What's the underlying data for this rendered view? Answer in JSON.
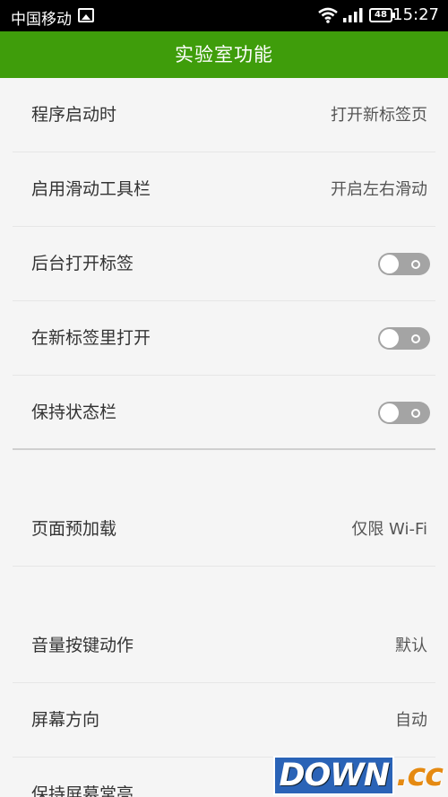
{
  "status_bar": {
    "carrier": "中国移动",
    "battery": "48",
    "time": "15:27",
    "icons": [
      "photo-icon",
      "wifi-icon",
      "signal-icon",
      "battery-icon"
    ]
  },
  "app_bar": {
    "title": "实验室功能"
  },
  "settings": {
    "launch": {
      "label": "程序启动时",
      "value": "打开新标签页"
    },
    "swipe_toolbar": {
      "label": "启用滑动工具栏",
      "value": "开启左右滑动"
    },
    "background_tabs": {
      "label": "后台打开标签",
      "enabled": false
    },
    "open_in_new_tab": {
      "label": "在新标签里打开",
      "enabled": false
    },
    "keep_status_bar": {
      "label": "保持状态栏",
      "enabled": false
    },
    "preload": {
      "label": "页面预加载",
      "value": "仅限 Wi-Fi"
    },
    "volume_keys": {
      "label": "音量按键动作",
      "value": "默认"
    },
    "orientation": {
      "label": "屏幕方向",
      "value": "自动"
    },
    "keep_screen_on": {
      "label": "保持屏幕常亮"
    }
  },
  "watermark": {
    "part1": "DOWN",
    "part2": ".cc"
  }
}
